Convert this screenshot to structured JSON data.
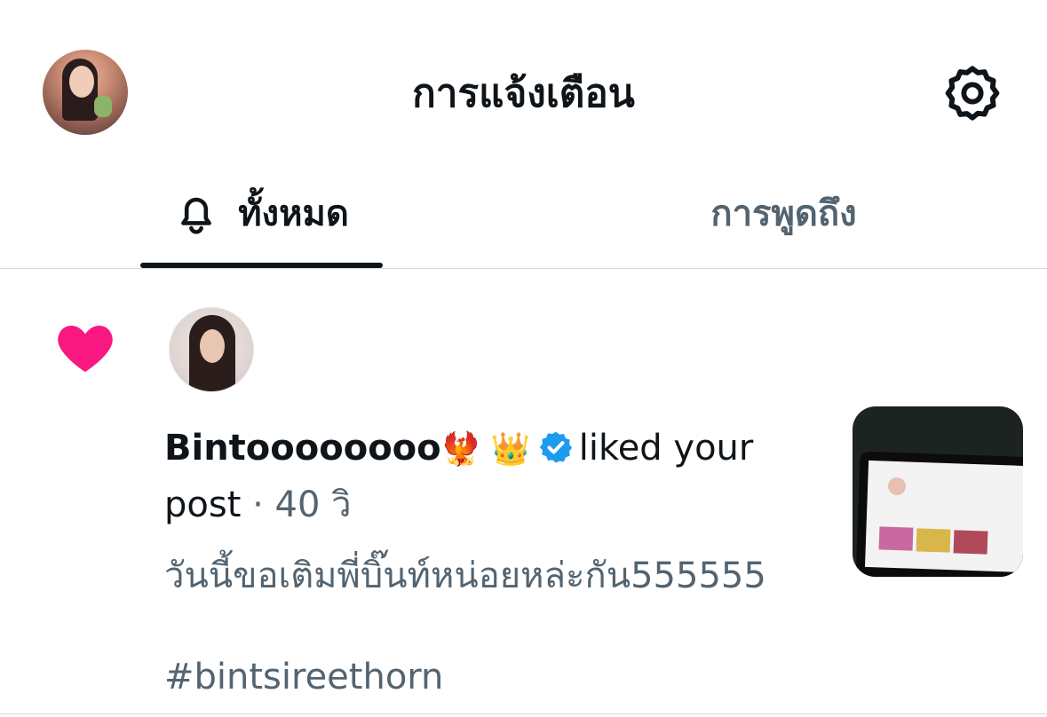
{
  "header": {
    "title": "การแจ้งเตือน",
    "avatar_icon": "profile-avatar",
    "settings_icon": "gear-icon"
  },
  "tabs": [
    {
      "label": "ทั้งหมด",
      "icon": "bell-icon",
      "active": true
    },
    {
      "label": "การพูดถึง",
      "active": false
    }
  ],
  "notification": {
    "type_icon": "heart-icon",
    "type_color": "#f91880",
    "user_name": "Bintoooooooo",
    "name_emojis": "🐦‍🔥 👑",
    "verified_color": "#1d9bf0",
    "action": "liked your post",
    "separator": "·",
    "time": "40 วิ",
    "post_text": "วันนี้ขอเติมพี่บิ๊นท์หน่อยหล่ะกัน555555",
    "post_hashtag": "#bintsireethorn"
  },
  "colors": {
    "text_primary": "#0f1419",
    "text_secondary": "#536471",
    "divider": "#cfd9de"
  }
}
